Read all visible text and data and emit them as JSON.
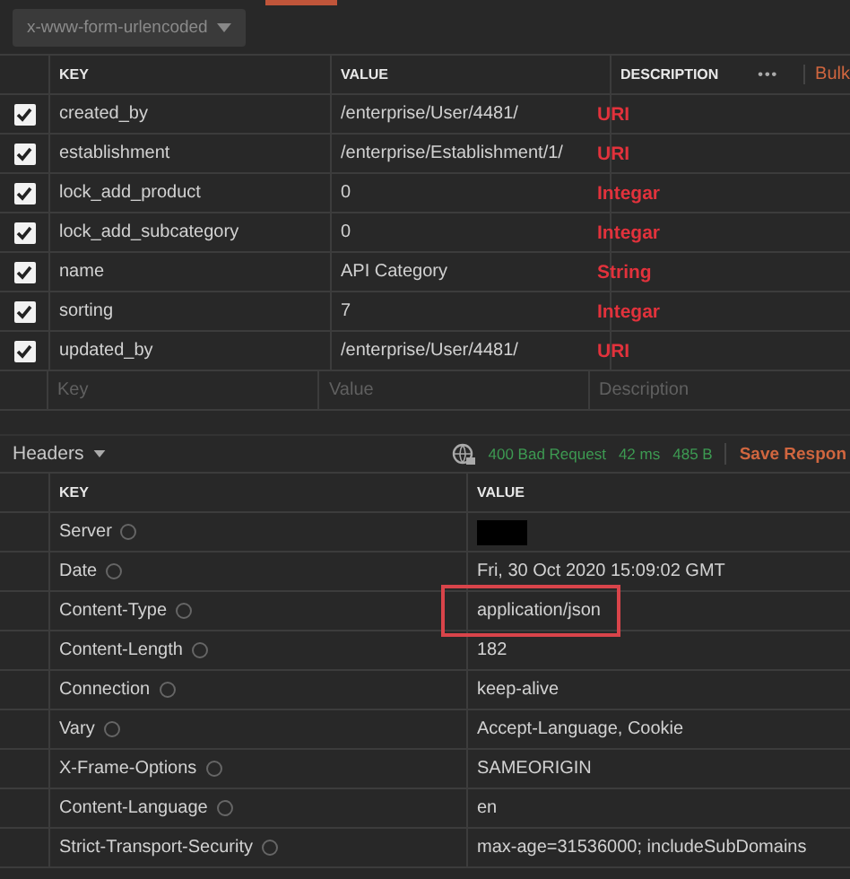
{
  "body_type": {
    "value": "x-www-form-urlencoded"
  },
  "params": {
    "columns": [
      "KEY",
      "VALUE",
      "DESCRIPTION"
    ],
    "more": "•••",
    "bulk": "Bulk",
    "rows": [
      {
        "checked": true,
        "key": "created_by",
        "value": "/enterprise/User/4481/",
        "annotation": "URI"
      },
      {
        "checked": true,
        "key": "establishment",
        "value": "/enterprise/Establishment/1/",
        "annotation": "URI"
      },
      {
        "checked": true,
        "key": "lock_add_product",
        "value": "0",
        "annotation": "Integar"
      },
      {
        "checked": true,
        "key": "lock_add_subcategory",
        "value": "0",
        "annotation": "Integar"
      },
      {
        "checked": true,
        "key": "name",
        "value": "API Category",
        "annotation": "String"
      },
      {
        "checked": true,
        "key": "sorting",
        "value": "7",
        "annotation": "Integar"
      },
      {
        "checked": true,
        "key": "updated_by",
        "value": "/enterprise/User/4481/",
        "annotation": "URI"
      }
    ],
    "new_row": [
      {
        "placeholder": "Key"
      },
      {
        "placeholder": "Value"
      },
      {
        "placeholder": "Description"
      }
    ]
  },
  "response": {
    "tab": "Headers",
    "status": "400 Bad Request",
    "time": "42 ms",
    "size": "485 B",
    "save": "Save Respon",
    "columns": [
      "KEY",
      "VALUE"
    ],
    "rows": [
      {
        "key": "Server",
        "value": null,
        "redacted": true,
        "highlighted": false
      },
      {
        "key": "Date",
        "value": "Fri, 30 Oct 2020 15:09:02 GMT",
        "redacted": false,
        "highlighted": false
      },
      {
        "key": "Content-Type",
        "value": "application/json",
        "redacted": false,
        "highlighted": true
      },
      {
        "key": "Content-Length",
        "value": "182",
        "redacted": false,
        "highlighted": false
      },
      {
        "key": "Connection",
        "value": "keep-alive",
        "redacted": false,
        "highlighted": false
      },
      {
        "key": "Vary",
        "value": "Accept-Language, Cookie",
        "redacted": false,
        "highlighted": false
      },
      {
        "key": "X-Frame-Options",
        "value": "SAMEORIGIN",
        "redacted": false,
        "highlighted": false
      },
      {
        "key": "Content-Language",
        "value": "en",
        "redacted": false,
        "highlighted": false
      },
      {
        "key": "Strict-Transport-Security",
        "value": "max-age=31536000; includeSubDomains",
        "redacted": false,
        "highlighted": false
      }
    ]
  }
}
